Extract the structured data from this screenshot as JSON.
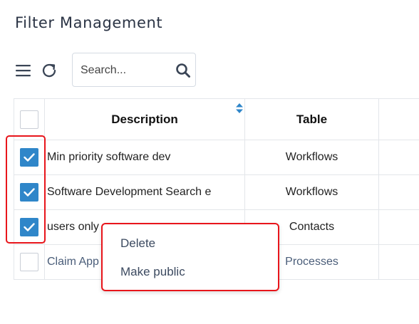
{
  "page": {
    "title": "Filter Management"
  },
  "toolbar": {
    "menu_icon": "hamburger-menu-icon",
    "refresh_icon": "refresh-icon",
    "search_placeholder": "Search...",
    "search_value": "",
    "search_icon": "magnifier-icon"
  },
  "table": {
    "headers": {
      "description": "Description",
      "table": "Table"
    },
    "rows": [
      {
        "checked": true,
        "description": "Min priority software dev",
        "table": "Workflows"
      },
      {
        "checked": true,
        "description": "Software Development Search e",
        "table": "Workflows"
      },
      {
        "checked": true,
        "description": "users only",
        "table": "Contacts"
      },
      {
        "checked": false,
        "description": "Claim App",
        "table": "Processes"
      }
    ]
  },
  "context_menu": {
    "delete_label": "Delete",
    "make_public_label": "Make public"
  },
  "colors": {
    "accent": "#2f86c9",
    "highlight": "#e8151b"
  }
}
